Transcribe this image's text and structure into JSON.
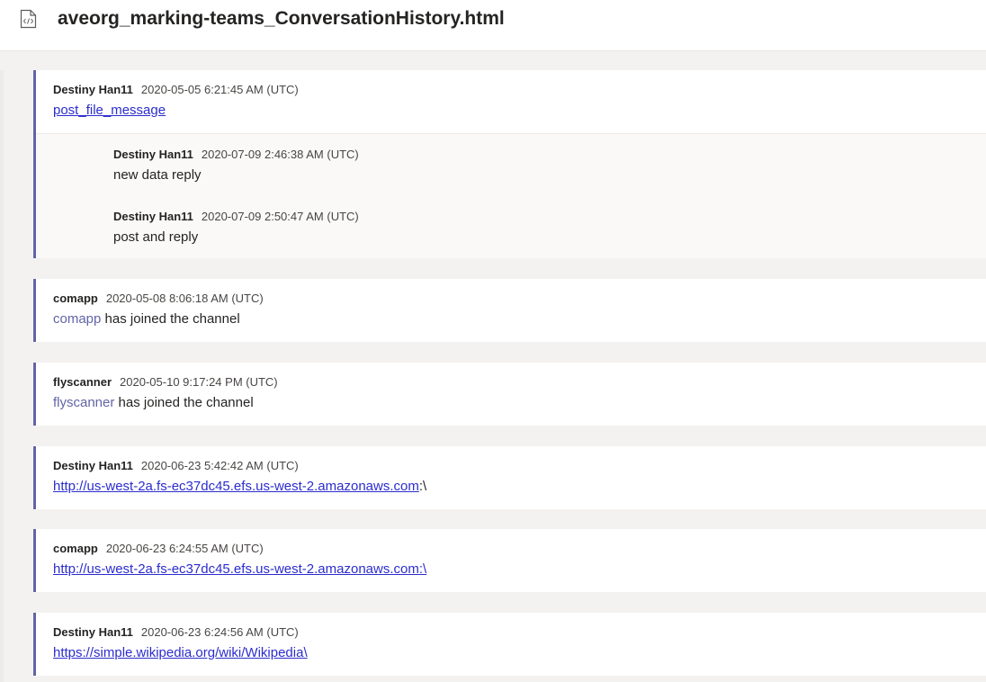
{
  "header": {
    "title": "aveorg_marking-teams_ConversationHistory.html",
    "icon": "html-file-icon"
  },
  "colors": {
    "accent": "#6264a7",
    "link": "#2c2cce",
    "canvas": "#f3f2f1"
  },
  "threads": [
    {
      "author": "Destiny Han11",
      "time": "2020-05-05 6:21:45 AM (UTC)",
      "link_text": "post_file_message",
      "replies": [
        {
          "author": "Destiny Han11",
          "time": "2020-07-09 2:46:38 AM (UTC)",
          "text": "new data reply"
        },
        {
          "author": "Destiny Han11",
          "time": "2020-07-09 2:50:47 AM (UTC)",
          "text": "post and reply"
        }
      ]
    },
    {
      "author": "comapp",
      "time": "2020-05-08 8:06:18 AM (UTC)",
      "mention": "comapp",
      "text": " has joined the channel"
    },
    {
      "author": "flyscanner",
      "time": "2020-05-10 9:17:24 PM (UTC)",
      "mention": "flyscanner",
      "text": " has joined the channel"
    },
    {
      "author": "Destiny Han11",
      "time": "2020-06-23 5:42:42 AM (UTC)",
      "link_text": "http://us-west-2a.fs-ec37dc45.efs.us-west-2.amazonaws.com",
      "suffix": ":\\"
    },
    {
      "author": "comapp",
      "time": "2020-06-23 6:24:55 AM (UTC)",
      "link_text": "http://us-west-2a.fs-ec37dc45.efs.us-west-2.amazonaws.com:\\"
    },
    {
      "author": "Destiny Han11",
      "time": "2020-06-23 6:24:56 AM (UTC)",
      "link_text": "https://simple.wikipedia.org/wiki/Wikipedia\\"
    }
  ]
}
